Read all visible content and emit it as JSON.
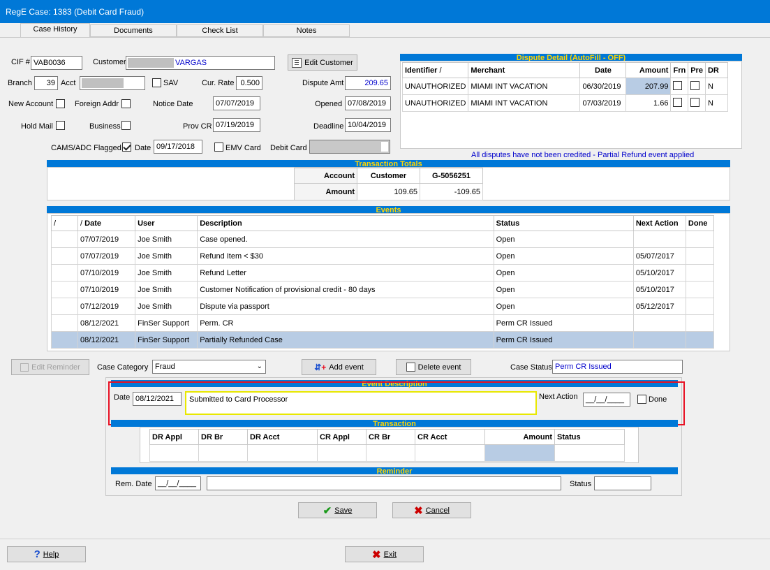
{
  "window": {
    "title": "RegE Case: 1383 (Debit Card Fraud)"
  },
  "tabs": [
    "Case History",
    "Documents",
    "Check List",
    "Notes"
  ],
  "header": {
    "cif_label": "CIF #",
    "cif_value": "VAB0036",
    "customer_label": "Customer",
    "customer_value": "VARGAS",
    "edit_customer": "Edit Customer",
    "branch_label": "Branch",
    "branch_value": "39",
    "acct_label": "Acct",
    "sav_label": "SAV",
    "cur_rate_label": "Cur. Rate",
    "cur_rate_value": "0.500",
    "dispute_amt_label": "Dispute Amt",
    "dispute_amt_value": "209.65",
    "new_account_label": "New Account",
    "foreign_addr_label": "Foreign Addr",
    "notice_date_label": "Notice Date",
    "notice_date_value": "07/07/2019",
    "opened_label": "Opened",
    "opened_value": "07/08/2019",
    "hold_mail_label": "Hold Mail",
    "business_label": "Business",
    "prov_cr_label": "Prov CR",
    "prov_cr_value": "07/19/2019",
    "deadline_label": "Deadline",
    "deadline_value": "10/04/2019",
    "cams_label": "CAMS/ADC Flagged",
    "cams_checked": true,
    "date_label": "Date",
    "date_value": "09/17/2018",
    "emv_label": "EMV Card",
    "debit_card_label": "Debit Card"
  },
  "dispute_detail": {
    "title": "Dispute Detail (AutoFill - OFF)",
    "columns": [
      "Identifier",
      "Merchant",
      "Date",
      "Amount",
      "Frn",
      "Pre",
      "DR"
    ],
    "rows": [
      {
        "identifier": "UNAUTHORIZED",
        "merchant": "MIAMI INT VACATION",
        "date": "06/30/2019",
        "amount": "207.99",
        "dr": "N"
      },
      {
        "identifier": "UNAUTHORIZED",
        "merchant": "MIAMI INT VACATION",
        "date": "07/03/2019",
        "amount": "1.66",
        "dr": "N"
      }
    ],
    "note": "All disputes have not been credited - Partial Refund event applied"
  },
  "transaction_totals": {
    "title": "Transaction Totals",
    "account_label": "Account",
    "amount_label": "Amount",
    "col1": "Customer",
    "col2": "G-5056251",
    "val1": "109.65",
    "val2": "-109.65"
  },
  "events": {
    "title": "Events",
    "columns": [
      "",
      "Date",
      "User",
      "Description",
      "Status",
      "Next Action",
      "Done"
    ],
    "rows": [
      {
        "date": "07/07/2019",
        "user": "Joe Smith",
        "description": "Case opened.",
        "status": "Open",
        "next": ""
      },
      {
        "date": "07/07/2019",
        "user": "Joe Smith",
        "description": "Refund Item < $30",
        "status": "Open",
        "next": "05/07/2017"
      },
      {
        "date": "07/10/2019",
        "user": "Joe Smith",
        "description": "Refund Letter",
        "status": "Open",
        "next": "05/10/2017"
      },
      {
        "date": "07/10/2019",
        "user": "Joe Smith",
        "description": "Customer Notification of provisional credit - 80 days",
        "status": "Open",
        "next": "05/10/2017"
      },
      {
        "date": "07/12/2019",
        "user": "Joe Smith",
        "description": "Dispute via passport",
        "status": "Open",
        "next": "05/12/2017"
      },
      {
        "date": "08/12/2021",
        "user": "FinSer Support",
        "description": "Perm. CR",
        "status": "Perm CR Issued",
        "next": ""
      },
      {
        "date": "08/12/2021",
        "user": "FinSer Support",
        "description": "Partially Refunded Case",
        "status": "Perm CR Issued",
        "next": ""
      }
    ]
  },
  "actions": {
    "edit_reminder": "Edit Reminder",
    "case_category_label": "Case Category",
    "case_category_value": "Fraud",
    "add_event": "Add event",
    "delete_event": "Delete event",
    "case_status_label": "Case Status",
    "case_status_value": "Perm CR Issued"
  },
  "event_description": {
    "title": "Event Description",
    "date_label": "Date",
    "date_value": "08/12/2021",
    "text": "Submitted to Card Processor",
    "next_action_label": "Next Action",
    "next_action_value": "__/__/____",
    "done_label": "Done"
  },
  "transaction": {
    "title": "Transaction",
    "columns": [
      "DR Appl",
      "DR Br",
      "DR Acct",
      "CR Appl",
      "CR Br",
      "CR Acct",
      "Amount",
      "Status"
    ]
  },
  "reminder": {
    "title": "Reminder",
    "rem_date_label": "Rem. Date",
    "rem_date_value": "__/__/____",
    "status_label": "Status"
  },
  "footer": {
    "save": "Save",
    "cancel": "Cancel",
    "help": "Help",
    "exit": "Exit"
  },
  "colors": {
    "accent": "#0078d7",
    "bar_text": "#ffd500",
    "highlight": "#e81123"
  }
}
